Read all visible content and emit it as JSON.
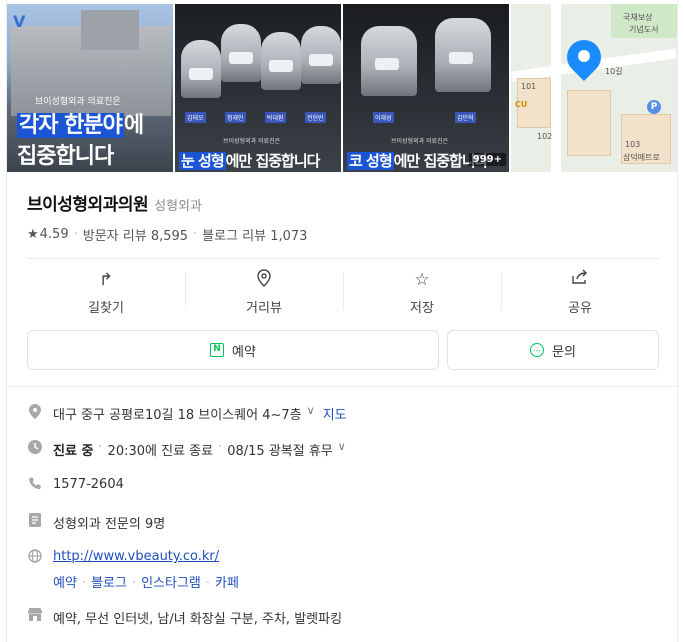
{
  "photos": {
    "p1": {
      "logo": "V",
      "sub": "브이성형외과 의료진은",
      "line1_hl": "각자 한분야",
      "line1_rest": "에",
      "line2": "집중합니다"
    },
    "p2": {
      "names": [
        "김태오",
        "정재인",
        "박대환",
        "전헌빈"
      ],
      "tag": "브이성형외과 의료진은",
      "hl": "눈 성형",
      "rest": "에만 집중합니다"
    },
    "p3": {
      "names": [
        "이재성",
        "김민혁"
      ],
      "tag": "브이성형외과 의료진은",
      "hl": "코 성형",
      "rest": "에만 집중합니다",
      "count": "999+"
    },
    "map": {
      "labels": [
        "국채보상",
        "기념도서",
        "10길",
        "101",
        "102",
        "103",
        "CU",
        "삼덕메트로"
      ]
    }
  },
  "place": {
    "name": "브이성형외과의원",
    "category": "성형외과",
    "rating": "4.59",
    "visitor_reviews": "방문자 리뷰 8,595",
    "blog_reviews": "블로그 리뷰 1,073"
  },
  "actions": [
    {
      "label": "길찾기",
      "icon": "directions-icon"
    },
    {
      "label": "거리뷰",
      "icon": "street-view-icon"
    },
    {
      "label": "저장",
      "icon": "star-icon"
    },
    {
      "label": "공유",
      "icon": "share-icon"
    }
  ],
  "buttons": {
    "reserve": "예약",
    "inquiry": "문의"
  },
  "info": {
    "address": "대구 중구 공평로10길 18 브이스퀘어 4~7층",
    "map_link": "지도",
    "status": "진료 중",
    "hours": "20:30에 진료 종료",
    "holiday": "08/15 광복절 휴무",
    "phone": "1577-2604",
    "doctors": "성형외과 전문의 9명",
    "url": "http://www.vbeauty.co.kr/",
    "sns": [
      "예약",
      "블로그",
      "인스타그램",
      "카페"
    ],
    "amenities": "예약, 무선 인터넷, 남/녀 화장실 구분, 주차, 발렛파킹"
  },
  "colors": {
    "accent_blue": "#1b55d6",
    "naver_green": "#03c75a",
    "link": "#1f4fbf",
    "map_pin": "#1a8cff"
  }
}
